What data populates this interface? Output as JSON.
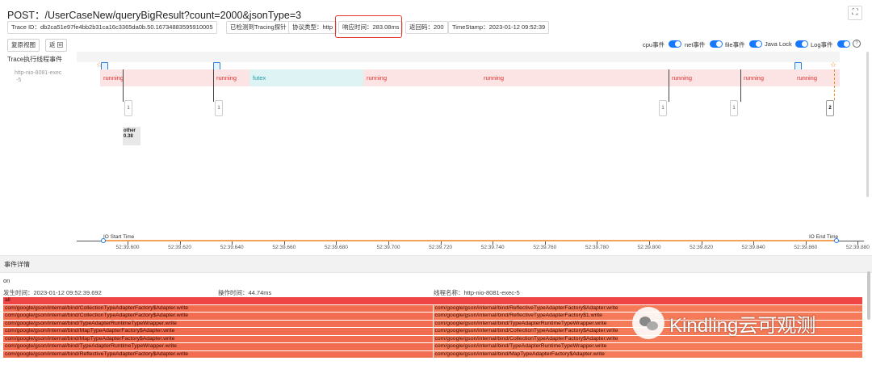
{
  "header": {
    "title": "POST：/UserCaseNew/queryBigResult?count=2000&jsonType=3",
    "trace_id": "Trace ID：db2ca51e97fe4bb2b31ca16c3365da0b.50.16734883595910005",
    "tracing_detected": "已检测到Tracing探针",
    "protocol": "协议类型：http",
    "response_time": "响应时间：283.08ms",
    "return_code": "返回码：200",
    "timestamp": "TimeStamp：2023-01-12 09:52:39"
  },
  "toolbar": {
    "reset_view": "复原视图",
    "back": "返 回",
    "toggles": [
      {
        "label": "cpu事件",
        "on": true
      },
      {
        "label": "net事件",
        "on": true
      },
      {
        "label": "file事件",
        "on": true
      },
      {
        "label": "Java Lock",
        "on": true
      },
      {
        "label": "Log事件",
        "on": true
      }
    ]
  },
  "trace_panel": {
    "title": "Trace执行线程事件",
    "thread_name_line1": "http-nio-8081-exec",
    "thread_name_line2": "-5",
    "segments": [
      {
        "label": "running",
        "type": "running"
      },
      {
        "label": "running",
        "type": "running"
      },
      {
        "label": "futex",
        "type": "futex"
      },
      {
        "label": "running",
        "type": "running"
      },
      {
        "label": "running",
        "type": "running"
      },
      {
        "label": "running",
        "type": "running"
      },
      {
        "label": "running",
        "type": "running"
      },
      {
        "label": "running",
        "type": "running"
      }
    ],
    "markers": [
      "1",
      "1",
      "1",
      "1",
      "2"
    ],
    "other_label": "other",
    "other_value": "0.38"
  },
  "axis": {
    "io_start": "IO Start Time",
    "io_end": "IO End Time",
    "ticks": [
      "52:39.600",
      "52:39.620",
      "52:39.640",
      "52:39.660",
      "52:39.680",
      "52:39.700",
      "52:39.720",
      "52:39.740",
      "52:39.760",
      "52:39.780",
      "52:39.800",
      "52:39.820",
      "52:39.840",
      "52:39.860",
      "52:39.880"
    ]
  },
  "event_detail": {
    "title": "事件详情",
    "type": "on",
    "occur_time": "发生时间：2023-01-12 09:52:39.692",
    "op_time": "操作时间：44.74ms",
    "thread_name": "线程名称：http-nio-8081-exec-5",
    "flame_root": "all",
    "flame_rows": [
      [
        "com/google/gson/internal/bind/CollectionTypeAdapterFactory$Adapter.write",
        "com/google/gson/internal/bind/ReflectiveTypeAdapterFactory$Adapter.write"
      ],
      [
        "com/google/gson/internal/bind/CollectionTypeAdapterFactory$Adapter.write",
        "com/google/gson/internal/bind/ReflectiveTypeAdapterFactory$1.write"
      ],
      [
        "com/google/gson/internal/bind/TypeAdapterRuntimeTypeWrapper.write",
        "com/google/gson/internal/bind/TypeAdapterRuntimeTypeWrapper.write"
      ],
      [
        "com/google/gson/internal/bind/MapTypeAdapterFactory$Adapter.write",
        "com/google/gson/internal/bind/CollectionTypeAdapterFactory$Adapter.write"
      ],
      [
        "com/google/gson/internal/bind/MapTypeAdapterFactory$Adapter.write",
        "com/google/gson/internal/bind/CollectionTypeAdapterFactory$Adapter.write"
      ],
      [
        "com/google/gson/internal/bind/TypeAdapterRuntimeTypeWrapper.write",
        "com/google/gson/internal/bind/TypeAdapterRuntimeTypeWrapper.write"
      ],
      [
        "com/google/gson/internal/bind/ReflectiveTypeAdapterFactory$Adapter.write",
        "com/google/gson/internal/bind/MapTypeAdapterFactory$Adapter.write"
      ]
    ]
  },
  "watermark": {
    "text": "Kindling云可观测"
  },
  "colors": {
    "accent": "#1677ff",
    "running_bg": "#fce4e4",
    "running_text": "#e03030",
    "futex_bg": "#def3f3",
    "futex_text": "#20a0a8",
    "highlight": "#e8332c"
  }
}
